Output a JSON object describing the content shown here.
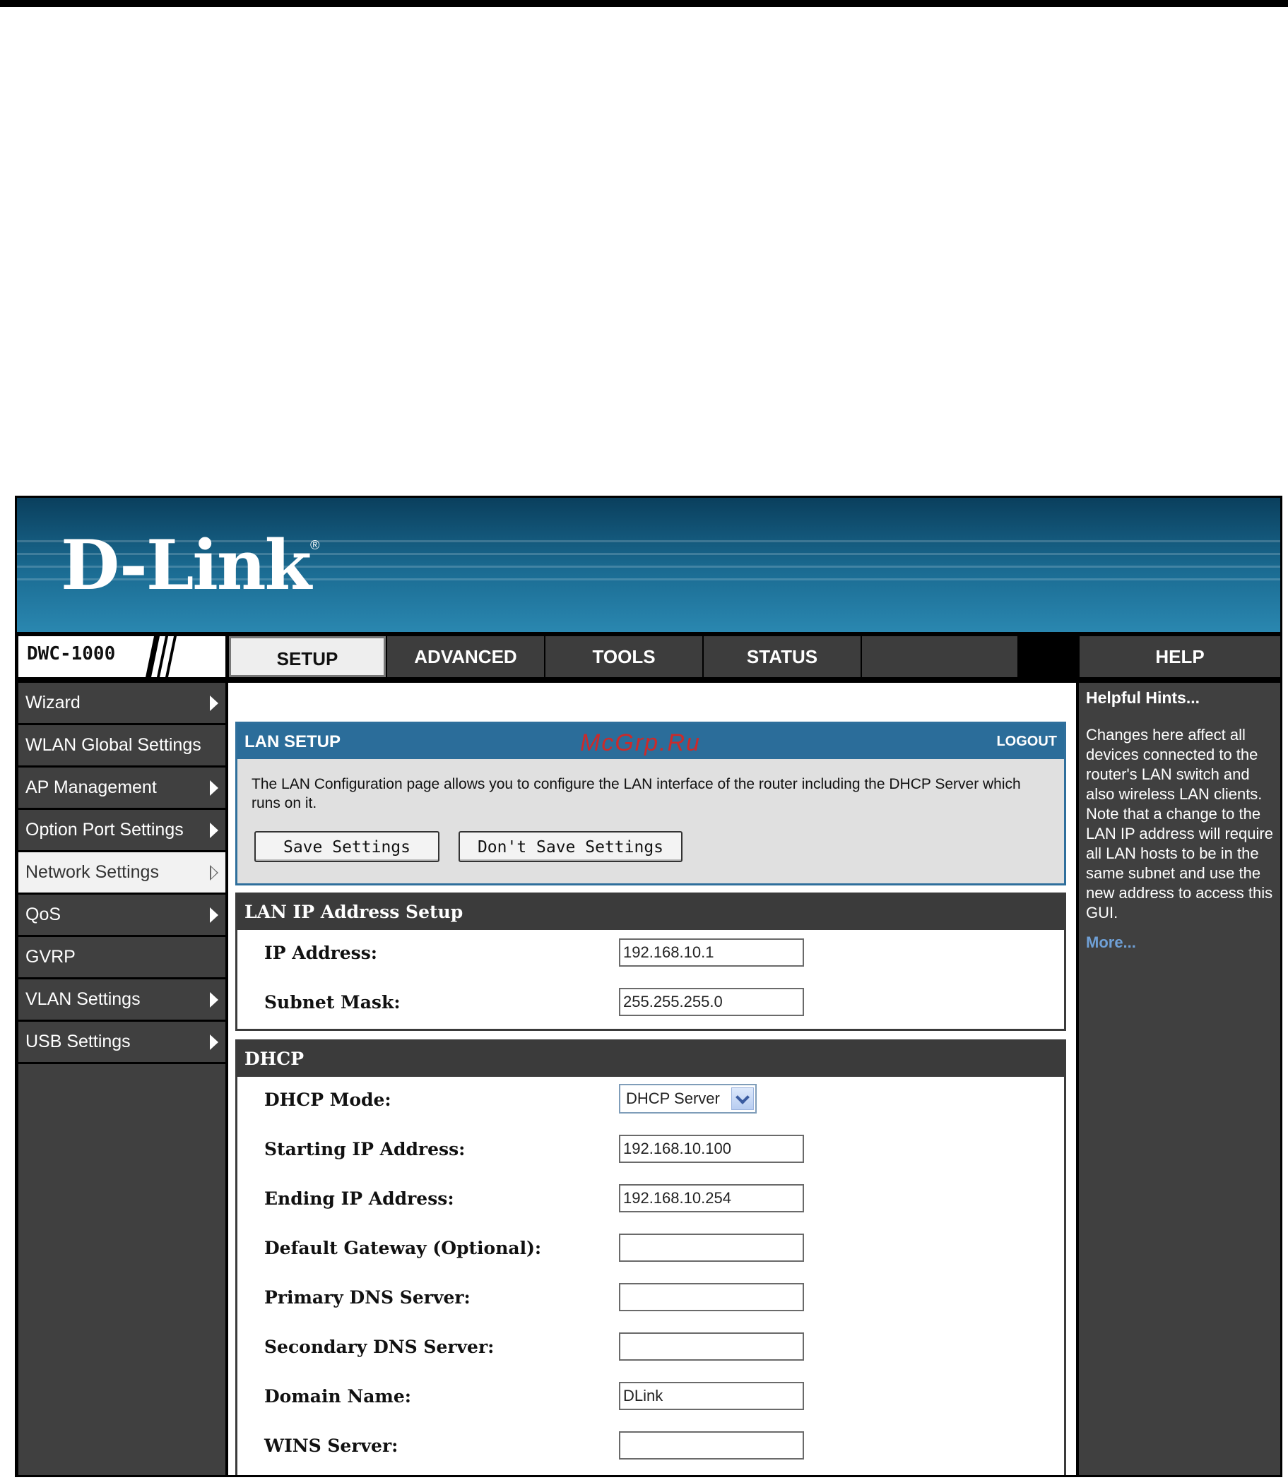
{
  "brand": {
    "logo_text": "D-Link",
    "registered_mark": "®",
    "model": "DWC-1000"
  },
  "tabs": [
    {
      "label": "SETUP",
      "active": true
    },
    {
      "label": "ADVANCED",
      "active": false
    },
    {
      "label": "TOOLS",
      "active": false
    },
    {
      "label": "STATUS",
      "active": false
    },
    {
      "label": "HELP",
      "active": false
    }
  ],
  "sidebar": {
    "items": [
      {
        "label": "Wizard",
        "has_arrow": true
      },
      {
        "label": "WLAN Global Settings",
        "has_arrow": false
      },
      {
        "label": "AP Management",
        "has_arrow": true
      },
      {
        "label": "Option Port Settings",
        "has_arrow": true
      },
      {
        "label": "Network Settings",
        "has_arrow": true,
        "active": true
      },
      {
        "label": "QoS",
        "has_arrow": true
      },
      {
        "label": "GVRP",
        "has_arrow": false
      },
      {
        "label": "VLAN Settings",
        "has_arrow": true
      },
      {
        "label": "USB Settings",
        "has_arrow": true
      }
    ]
  },
  "lan_setup": {
    "title": "LAN SETUP",
    "logout": "LOGOUT",
    "watermark": "McGrp.Ru",
    "description": "The LAN Configuration page allows you to configure the LAN interface of the router including the DHCP Server which runs on it.",
    "save_label": "Save Settings",
    "dont_save_label": "Don't Save Settings"
  },
  "lan_ip": {
    "title": "LAN IP Address Setup",
    "ip_label": "IP Address:",
    "ip_value": "192.168.10.1",
    "mask_label": "Subnet Mask:",
    "mask_value": "255.255.255.0"
  },
  "dhcp": {
    "title": "DHCP",
    "mode_label": "DHCP Mode:",
    "mode_value": "DHCP Server",
    "start_label": "Starting IP Address:",
    "start_value": "192.168.10.100",
    "end_label": "Ending IP Address:",
    "end_value": "192.168.10.254",
    "gateway_label": "Default Gateway (Optional):",
    "gateway_value": "",
    "dns1_label": "Primary DNS Server:",
    "dns1_value": "",
    "dns2_label": "Secondary DNS Server:",
    "dns2_value": "",
    "domain_label": "Domain Name:",
    "domain_value": "DLink",
    "wins_label": "WINS Server:",
    "wins_value": ""
  },
  "help": {
    "title": "Helpful Hints...",
    "text": "Changes here affect all devices connected to the router's LAN switch and also wireless LAN clients. Note that a change to the LAN IP address will require all LAN hosts to be in the same subnet and use the new address to access this GUI.",
    "more": "More..."
  },
  "colors": {
    "accent_blue": "#2b6d9a",
    "panel_dark": "#404040",
    "section_header": "#3b3b3b",
    "watermark_red": "#cc2a2a"
  }
}
